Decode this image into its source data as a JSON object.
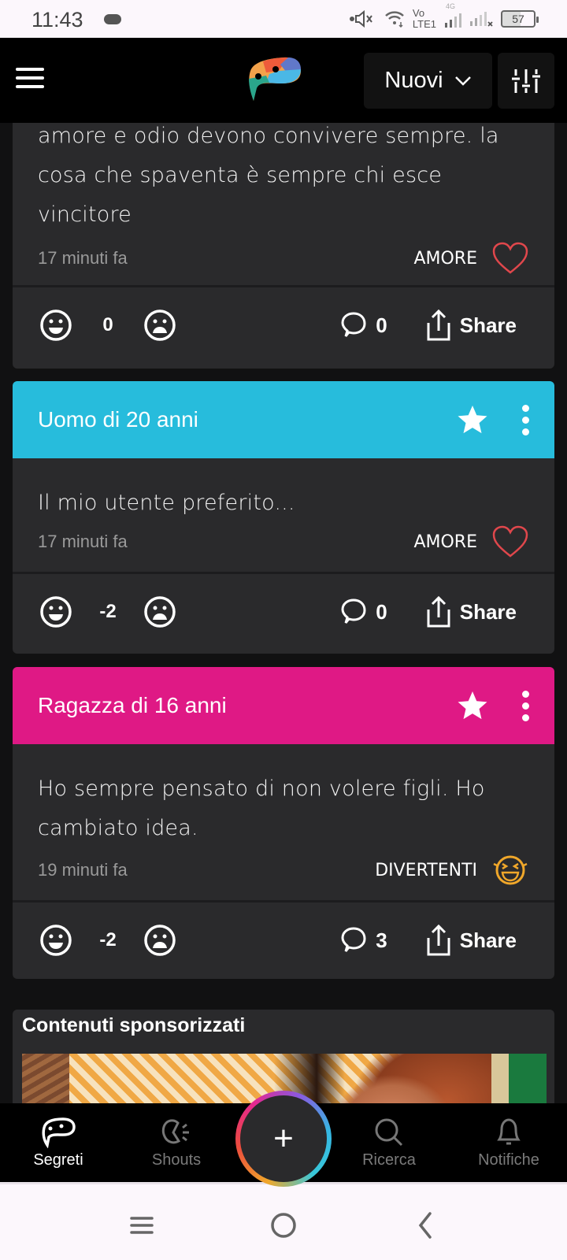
{
  "status_bar": {
    "time": "11:43",
    "network_label_top": "Vo",
    "network_label_bottom": "LTE1",
    "network_type": "4G",
    "battery": "57"
  },
  "top_bar": {
    "sort_label": "Nuovi",
    "icons": [
      "menu-icon",
      "app-logo",
      "chevron-down-icon",
      "filter-sliders-icon"
    ]
  },
  "posts": [
    {
      "author": "",
      "text": "amore e odio devono convivere sempre. la cosa che spaventa è sempre chi esce vincitore",
      "time_ago": "17 minuti fa",
      "category": "AMORE",
      "category_icon": "heart-outline-icon",
      "score": "0",
      "comments": "0",
      "share_label": "Share",
      "header_color": null
    },
    {
      "author": "Uomo di 20 anni",
      "text": "Il mio utente preferito...",
      "time_ago": "17 minuti fa",
      "category": "AMORE",
      "category_icon": "heart-outline-icon",
      "score": "-2",
      "comments": "0",
      "share_label": "Share",
      "header_color": "#27bcdc"
    },
    {
      "author": "Ragazza di 16 anni",
      "text": "Ho sempre pensato di non volere figli. Ho cambiato idea.",
      "time_ago": "19 minuti fa",
      "category": "DIVERTENTI",
      "category_icon": "laughing-face-icon",
      "score": "-2",
      "comments": "3",
      "share_label": "Share",
      "header_color": "#df1985"
    }
  ],
  "sponsored": {
    "label": "Contenuti sponsorizzati"
  },
  "bottom_nav": {
    "items": [
      {
        "label": "Segreti",
        "icon": "secrets-bubble-icon",
        "active": true
      },
      {
        "label": "Shouts",
        "icon": "shouts-icon",
        "active": false
      },
      {
        "label": "Ricerca",
        "icon": "search-icon",
        "active": false
      },
      {
        "label": "Notifiche",
        "icon": "bell-icon",
        "active": false
      }
    ],
    "fab_label": "+"
  },
  "colors": {
    "background": "#111112",
    "card": "#2a2a2c",
    "heart": "#e0474c",
    "laugh": "#f0a72a"
  }
}
